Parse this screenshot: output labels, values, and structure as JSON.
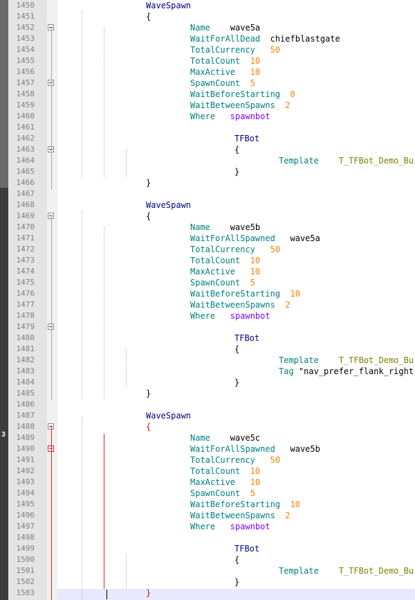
{
  "editor": {
    "lines": [
      {
        "n": "1450",
        "indent": 16,
        "parts": [
          [
            "WaveSpawn",
            "block"
          ]
        ],
        "fold": ""
      },
      {
        "n": "1451",
        "indent": 16,
        "parts": [
          [
            "{",
            "plain"
          ]
        ],
        "fold": ""
      },
      {
        "n": "1452",
        "indent": 24,
        "parts": [
          [
            "Name",
            "key"
          ],
          [
            "    wave5a",
            "plain"
          ]
        ],
        "fold": "box"
      },
      {
        "n": "1453",
        "indent": 24,
        "parts": [
          [
            "WaitForAllDead",
            "key"
          ],
          [
            "  chiefblastgate",
            "plain"
          ]
        ],
        "fold": ""
      },
      {
        "n": "1454",
        "indent": 24,
        "parts": [
          [
            "TotalCurrency",
            "key"
          ],
          [
            "   50",
            "num"
          ]
        ],
        "fold": ""
      },
      {
        "n": "1455",
        "indent": 24,
        "parts": [
          [
            "TotalCount",
            "key"
          ],
          [
            "  10",
            "num"
          ]
        ],
        "fold": ""
      },
      {
        "n": "1456",
        "indent": 24,
        "parts": [
          [
            "MaxActive",
            "key"
          ],
          [
            "   10",
            "num"
          ]
        ],
        "fold": ""
      },
      {
        "n": "1457",
        "indent": 24,
        "parts": [
          [
            "SpawnCount",
            "key"
          ],
          [
            "  5",
            "num"
          ]
        ],
        "fold": "box"
      },
      {
        "n": "1458",
        "indent": 24,
        "parts": [
          [
            "WaitBeforeStarting",
            "key"
          ],
          [
            "  0",
            "num"
          ]
        ],
        "fold": ""
      },
      {
        "n": "1459",
        "indent": 24,
        "parts": [
          [
            "WaitBetweenSpawns",
            "key"
          ],
          [
            "  2",
            "num"
          ]
        ],
        "fold": ""
      },
      {
        "n": "1460",
        "indent": 24,
        "parts": [
          [
            "Where",
            "key"
          ],
          [
            "   spawnbot",
            "kw"
          ]
        ],
        "fold": ""
      },
      {
        "n": "1461",
        "indent": 0,
        "parts": [],
        "fold": ""
      },
      {
        "n": "1462",
        "indent": 32,
        "parts": [
          [
            "TFBot",
            "block"
          ]
        ],
        "fold": ""
      },
      {
        "n": "1463",
        "indent": 32,
        "parts": [
          [
            "{",
            "plain"
          ]
        ],
        "fold": "box"
      },
      {
        "n": "1464",
        "indent": 40,
        "parts": [
          [
            "Template",
            "key"
          ],
          [
            "    T_TFBot_Demo_Burst",
            "tpl"
          ]
        ],
        "fold": ""
      },
      {
        "n": "1465",
        "indent": 32,
        "parts": [
          [
            "}",
            "plain"
          ]
        ],
        "fold": ""
      },
      {
        "n": "1466",
        "indent": 16,
        "parts": [
          [
            "}",
            "plain"
          ]
        ],
        "fold": ""
      },
      {
        "n": "1467",
        "indent": 0,
        "parts": [],
        "fold": ""
      },
      {
        "n": "1468",
        "indent": 16,
        "parts": [
          [
            "WaveSpawn",
            "block"
          ]
        ],
        "fold": ""
      },
      {
        "n": "1469",
        "indent": 16,
        "parts": [
          [
            "{",
            "plain"
          ]
        ],
        "fold": "box"
      },
      {
        "n": "1470",
        "indent": 24,
        "parts": [
          [
            "Name",
            "key"
          ],
          [
            "    wave5b",
            "plain"
          ]
        ],
        "fold": ""
      },
      {
        "n": "1471",
        "indent": 24,
        "parts": [
          [
            "WaitForAllSpawned",
            "key"
          ],
          [
            "   wave5a",
            "plain"
          ]
        ],
        "fold": ""
      },
      {
        "n": "1472",
        "indent": 24,
        "parts": [
          [
            "TotalCurrency",
            "key"
          ],
          [
            "   50",
            "num"
          ]
        ],
        "fold": ""
      },
      {
        "n": "1473",
        "indent": 24,
        "parts": [
          [
            "TotalCount",
            "key"
          ],
          [
            "  10",
            "num"
          ]
        ],
        "fold": ""
      },
      {
        "n": "1474",
        "indent": 24,
        "parts": [
          [
            "MaxActive",
            "key"
          ],
          [
            "   10",
            "num"
          ]
        ],
        "fold": ""
      },
      {
        "n": "1475",
        "indent": 24,
        "parts": [
          [
            "SpawnCount",
            "key"
          ],
          [
            "  5",
            "num"
          ]
        ],
        "fold": ""
      },
      {
        "n": "1476",
        "indent": 24,
        "parts": [
          [
            "WaitBeforeStarting",
            "key"
          ],
          [
            "  10",
            "num"
          ]
        ],
        "fold": ""
      },
      {
        "n": "1477",
        "indent": 24,
        "parts": [
          [
            "WaitBetweenSpawns",
            "key"
          ],
          [
            "  2",
            "num"
          ]
        ],
        "fold": ""
      },
      {
        "n": "1478",
        "indent": 24,
        "parts": [
          [
            "Where",
            "key"
          ],
          [
            "   spawnbot",
            "kw"
          ]
        ],
        "fold": ""
      },
      {
        "n": "1479",
        "indent": 0,
        "parts": [],
        "fold": "box"
      },
      {
        "n": "1480",
        "indent": 32,
        "parts": [
          [
            "TFBot",
            "block"
          ]
        ],
        "fold": ""
      },
      {
        "n": "1481",
        "indent": 32,
        "parts": [
          [
            "{",
            "plain"
          ]
        ],
        "fold": ""
      },
      {
        "n": "1482",
        "indent": 40,
        "parts": [
          [
            "Template",
            "key"
          ],
          [
            "    T_TFBot_Demo_Burst",
            "tpl"
          ]
        ],
        "fold": ""
      },
      {
        "n": "1483",
        "indent": 40,
        "parts": [
          [
            "Tag ",
            "key"
          ],
          [
            "\"nav_prefer_flank_right\"",
            "str"
          ]
        ],
        "fold": ""
      },
      {
        "n": "1484",
        "indent": 32,
        "parts": [
          [
            "}",
            "plain"
          ]
        ],
        "fold": ""
      },
      {
        "n": "1485",
        "indent": 16,
        "parts": [
          [
            "}",
            "plain"
          ]
        ],
        "fold": ""
      },
      {
        "n": "1486",
        "indent": 0,
        "parts": [],
        "fold": ""
      },
      {
        "n": "1487",
        "indent": 16,
        "parts": [
          [
            "WaveSpawn",
            "block"
          ]
        ],
        "fold": ""
      },
      {
        "n": "1488",
        "indent": 16,
        "parts": [
          [
            "{",
            "redbrace"
          ]
        ],
        "fold": "box"
      },
      {
        "n": "1489",
        "indent": 24,
        "parts": [
          [
            "Name",
            "key"
          ],
          [
            "    wave5c",
            "plain"
          ]
        ],
        "fold": ""
      },
      {
        "n": "1490",
        "indent": 24,
        "parts": [
          [
            "WaitForAllSpawned",
            "key"
          ],
          [
            "   wave5b",
            "plain"
          ]
        ],
        "fold": "redbox"
      },
      {
        "n": "1491",
        "indent": 24,
        "parts": [
          [
            "TotalCurrency",
            "key"
          ],
          [
            "   50",
            "num"
          ]
        ],
        "fold": ""
      },
      {
        "n": "1492",
        "indent": 24,
        "parts": [
          [
            "TotalCount",
            "key"
          ],
          [
            "  10",
            "num"
          ]
        ],
        "fold": ""
      },
      {
        "n": "1493",
        "indent": 24,
        "parts": [
          [
            "MaxActive",
            "key"
          ],
          [
            "   10",
            "num"
          ]
        ],
        "fold": ""
      },
      {
        "n": "1494",
        "indent": 24,
        "parts": [
          [
            "SpawnCount",
            "key"
          ],
          [
            "  5",
            "num"
          ]
        ],
        "fold": ""
      },
      {
        "n": "1495",
        "indent": 24,
        "parts": [
          [
            "WaitBeforeStarting",
            "key"
          ],
          [
            "  10",
            "num"
          ]
        ],
        "fold": ""
      },
      {
        "n": "1496",
        "indent": 24,
        "parts": [
          [
            "WaitBetweenSpawns",
            "key"
          ],
          [
            "  2",
            "num"
          ]
        ],
        "fold": ""
      },
      {
        "n": "1497",
        "indent": 24,
        "parts": [
          [
            "Where",
            "key"
          ],
          [
            "   spawnbot",
            "kw"
          ]
        ],
        "fold": ""
      },
      {
        "n": "1498",
        "indent": 0,
        "parts": [],
        "fold": ""
      },
      {
        "n": "1499",
        "indent": 32,
        "parts": [
          [
            "TFBot",
            "block"
          ]
        ],
        "fold": ""
      },
      {
        "n": "1500",
        "indent": 32,
        "parts": [
          [
            "{",
            "plain"
          ]
        ],
        "fold": ""
      },
      {
        "n": "1501",
        "indent": 40,
        "parts": [
          [
            "Template",
            "key"
          ],
          [
            "    T_TFBot_Demo_Burst",
            "tpl"
          ]
        ],
        "fold": ""
      },
      {
        "n": "1502",
        "indent": 32,
        "parts": [
          [
            "}",
            "plain"
          ]
        ],
        "fold": ""
      },
      {
        "n": "1503",
        "indent": 16,
        "parts": [
          [
            "}",
            "redbrace"
          ]
        ],
        "fold": ""
      }
    ],
    "left_strip_mark": "3",
    "colors": {
      "block": "#000080",
      "key": "#008080",
      "keyword": "#8000ff",
      "number": "#ff8000",
      "template": "#808000",
      "brace_match": "#ff0000",
      "line_number": "#7f7f7f",
      "current_line": "#e8e8ff"
    }
  }
}
